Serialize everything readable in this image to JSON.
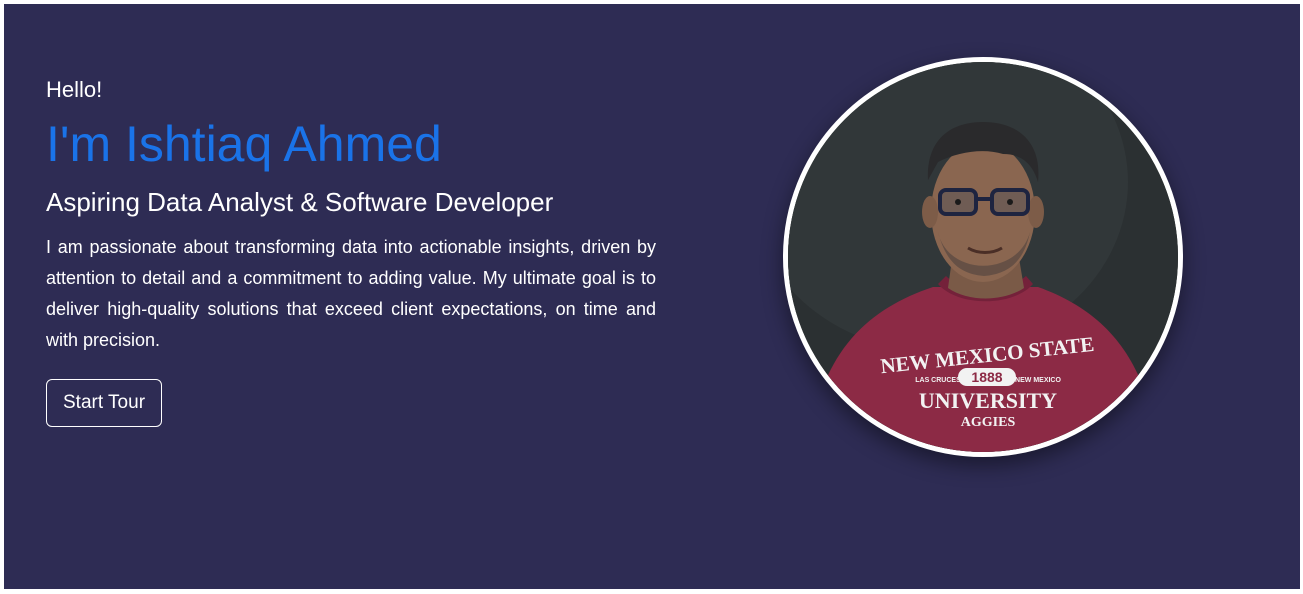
{
  "hero": {
    "greeting": "Hello!",
    "name": "I'm Ishtiaq Ahmed",
    "role": "Aspiring Data Analyst & Software Developer",
    "bio": "I am passionate about transforming data into actionable insights, driven by attention to detail and a commitment to adding value. My ultimate goal is to deliver high-quality solutions that exceed client expectations, on time and with precision.",
    "cta_label": "Start Tour"
  },
  "portrait": {
    "shirt_text": {
      "line1": "NEW MEXICO STATE",
      "badge": "1888",
      "side_left": "LAS CRUCES",
      "side_right": "NEW MEXICO",
      "line2": "UNIVERSITY",
      "line3": "AGGIES"
    }
  },
  "colors": {
    "background": "#2e2c54",
    "accent": "#1a73e8",
    "text": "#ffffff",
    "shirt": "#8c2a45"
  }
}
